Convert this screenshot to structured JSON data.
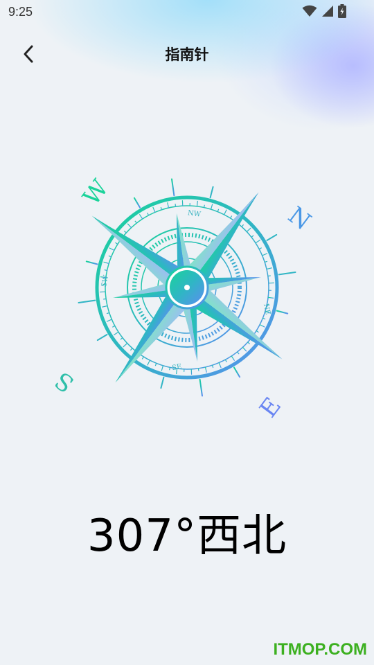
{
  "status_bar": {
    "time": "9:25",
    "icons": [
      "wifi-icon",
      "cellular-signal-icon",
      "battery-charging-icon"
    ]
  },
  "nav": {
    "back_icon": "chevron-left-icon",
    "title": "指南针"
  },
  "compass": {
    "cardinal_labels": {
      "north": "N",
      "east": "E",
      "south": "S",
      "west": "W"
    },
    "intercardinal_labels": {
      "nw": "NW",
      "ne": "NE",
      "se": "SE",
      "sw": "SW"
    },
    "colors": {
      "gradient_start": "#1ad39a",
      "gradient_mid": "#2fb6c4",
      "gradient_end": "#5b8ef0"
    }
  },
  "heading": {
    "reading": "307°西北"
  },
  "watermark": {
    "text": "ITMOP.COM",
    "color": "#3cb020"
  }
}
